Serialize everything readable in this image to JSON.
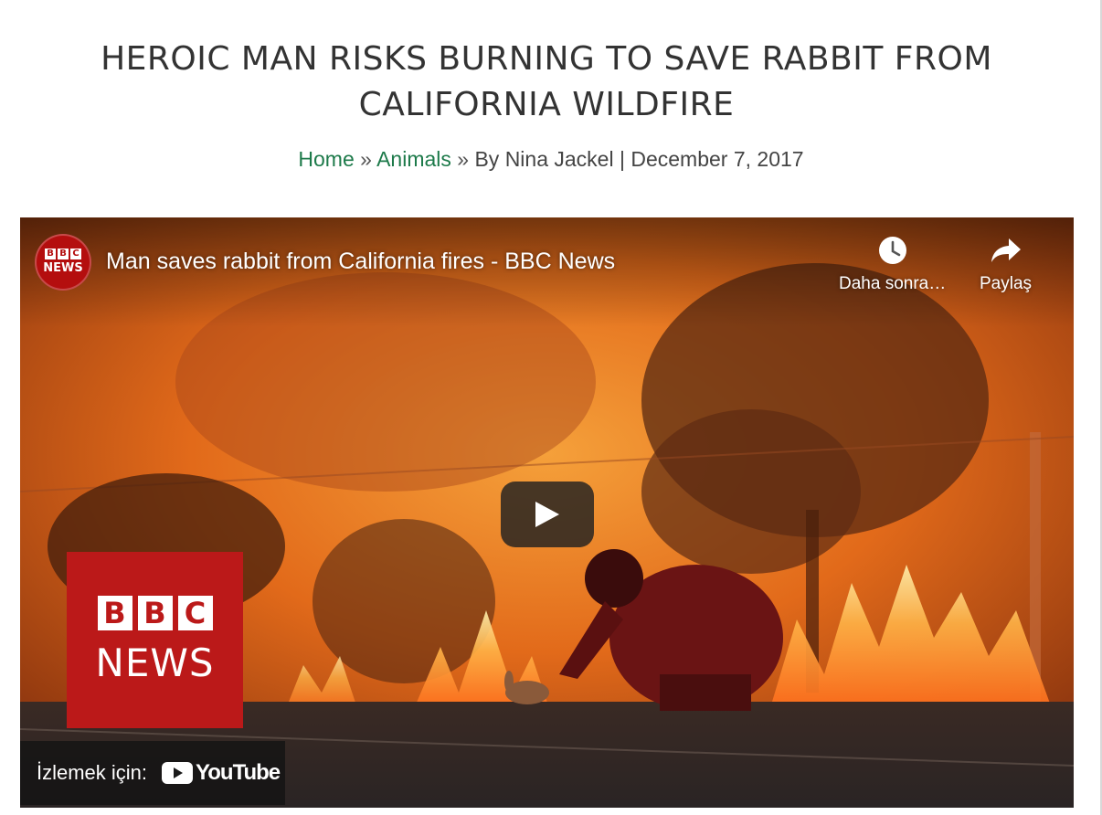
{
  "article": {
    "title": "HEROIC MAN RISKS BURNING TO SAVE RABBIT FROM CALIFORNIA WILDFIRE",
    "breadcrumb": {
      "home": "Home",
      "separator": "»",
      "category": "Animals",
      "byline": "By Nina Jackel",
      "divider": "|",
      "date": "December 7, 2017"
    }
  },
  "video": {
    "channel": {
      "logo_letters": [
        "B",
        "B",
        "C"
      ],
      "logo_news": "NEWS"
    },
    "title": "Man saves rabbit from California fires - BBC News",
    "actions": {
      "watch_later": "Daha sonra…",
      "share": "Paylaş"
    },
    "play_icon": "play-icon",
    "brand_overlay": {
      "letters": [
        "B",
        "B",
        "C"
      ],
      "news": "NEWS"
    },
    "watch_on": {
      "label": "İzlemek için:",
      "logo_text": "YouTube"
    }
  },
  "colors": {
    "title": "#333333",
    "link": "#1d7a4a",
    "bbc_red": "#bb1919",
    "fire_orange": "#d85a14"
  }
}
